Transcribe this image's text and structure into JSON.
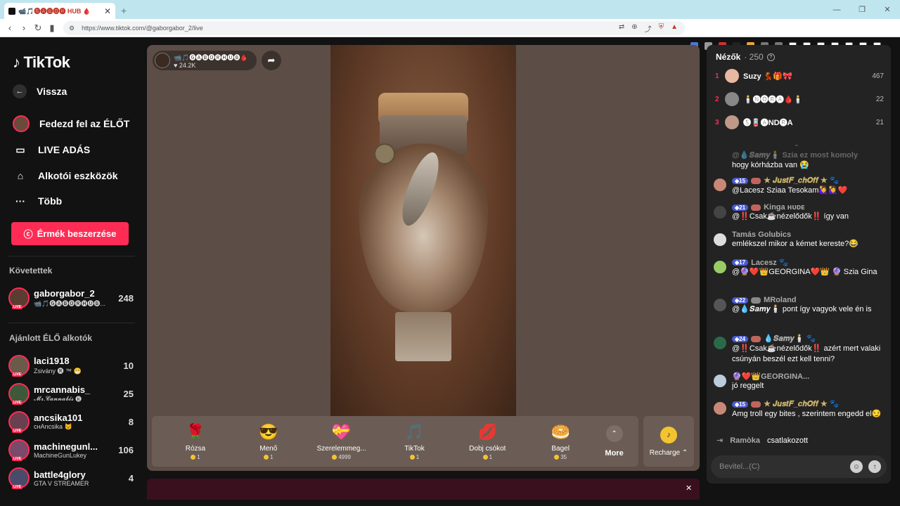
{
  "browser": {
    "tab_title": "📹🎵🅖🅐🅑🅞🅡 HUB 🩸",
    "url": "https://www.tiktok.com/@gaborgabor_2/live"
  },
  "sidebar": {
    "logo": "TikTok",
    "nav": [
      {
        "label": "Vissza",
        "icon": "arrow-left-icon"
      },
      {
        "label": "Fedezd fel az ÉLŐT",
        "icon": "avatar-icon"
      },
      {
        "label": "LIVE ADÁS",
        "icon": "camera-icon"
      },
      {
        "label": "Alkotói eszközök",
        "icon": "creator-tools-icon"
      },
      {
        "label": "Több",
        "icon": "more-icon"
      }
    ],
    "coins_button": "Érmék beszerzése",
    "following_title": "Követettek",
    "following": [
      {
        "name": "gaborgabor_2",
        "sub": "📹🎵🅖🅐🅑🅞🅡🅗🅤🅑...",
        "count": "248"
      }
    ],
    "recommended_title": "Ajánlott ÉLŐ alkotók",
    "recommended": [
      {
        "name": "laci1918",
        "sub": "Zsivány 🅡 ™ 😁",
        "count": "10"
      },
      {
        "name": "mrcannabis_",
        "sub": "𝓜𝓻.𝓒𝓪𝓷𝓷𝓪𝓫𝓲𝓼 🅡",
        "count": "25"
      },
      {
        "name": "ancsika101",
        "sub": "ᴄнAncsika 😾",
        "count": "8"
      },
      {
        "name": "machinegunl...",
        "sub": "MachineGunLukey",
        "count": "106"
      },
      {
        "name": "battle4glory",
        "sub": "GTA V STREAMER",
        "count": "4"
      }
    ]
  },
  "stream": {
    "host_name": "📹🎵🅖🅐🅑🅞🅡🅗🅤🅑🩸",
    "host_likes": "24.2K"
  },
  "gifts": [
    {
      "name": "Rózsa",
      "price": "1",
      "emoji": "🌹"
    },
    {
      "name": "Menő",
      "price": "1",
      "emoji": "😎"
    },
    {
      "name": "Szerelemmeg...",
      "price": "4999",
      "emoji": "💝"
    },
    {
      "name": "TikTok",
      "price": "1",
      "emoji": "🎵"
    },
    {
      "name": "Dobj csókot",
      "price": "1",
      "emoji": "💋"
    },
    {
      "name": "Bagel",
      "price": "35",
      "emoji": "🥯"
    }
  ],
  "gift_more": "More",
  "recharge": "Recharge",
  "chat": {
    "viewers_label": "Nézők",
    "viewers_count": "· 250",
    "top_viewers": [
      {
        "rank": "1",
        "name": "Suzy 💃🎁🎀",
        "score": "467"
      },
      {
        "rank": "2",
        "name": "🕯️🅝🅞🅡🅐🩸🕯️",
        "score": "22"
      },
      {
        "rank": "3",
        "name": "🅢🪫🅐ND🅡A",
        "score": "21"
      }
    ],
    "messages": [
      {
        "level": "",
        "user": "@💧𝑺𝒂𝒎𝒚🕯️ Szia ez most komoly",
        "text": "hogy kórházba van 😭"
      },
      {
        "level": "15",
        "user": "★ 𝑱𝒖𝒔𝒕𝑭_𝒄𝒉𝑶𝒇𝒇 ★ 🐾",
        "text": "@Lacesz Sziaa Tesokam🙋‍♀️🙋‍♀️❤️"
      },
      {
        "level": "21",
        "user": "Kinga ʜᴜᴅᴇ",
        "text": "@‼️Csak☕nézelődők‼️ így van"
      },
      {
        "level": "",
        "user": "Tamás Golubics",
        "text": "emlékszel mikor a kémet kereste?😂"
      },
      {
        "level": "17",
        "user": "Lacesz 🐾",
        "text": "@🔮❤️👑GEORGINA❤️👑 🔮 Szia Gina"
      },
      {
        "level": "22",
        "user": "MRoland",
        "text": "@💧𝑺𝒂𝒎𝒚🕯️ pont így vagyok vele én is"
      },
      {
        "level": "24",
        "user": "💧𝑺𝒂𝒎𝒚🕯️ 🐾",
        "text": "@‼️Csak☕nézelődők‼️ azért mert valaki csúnyán beszél ezt kell tenni?"
      },
      {
        "level": "",
        "user": "🔮❤️👑GEORGINA...",
        "text": "jó reggelt"
      },
      {
        "level": "15",
        "user": "★ 𝑱𝒖𝒔𝒕𝑭_𝒄𝒉𝑶𝒇𝒇 ★ 🐾",
        "text": "Amg troll egy bites , szerintem engedd el😏"
      }
    ],
    "join_user": "Ramòka",
    "join_text": "csatlakozott",
    "input_placeholder": "Bevitel...(C)"
  }
}
